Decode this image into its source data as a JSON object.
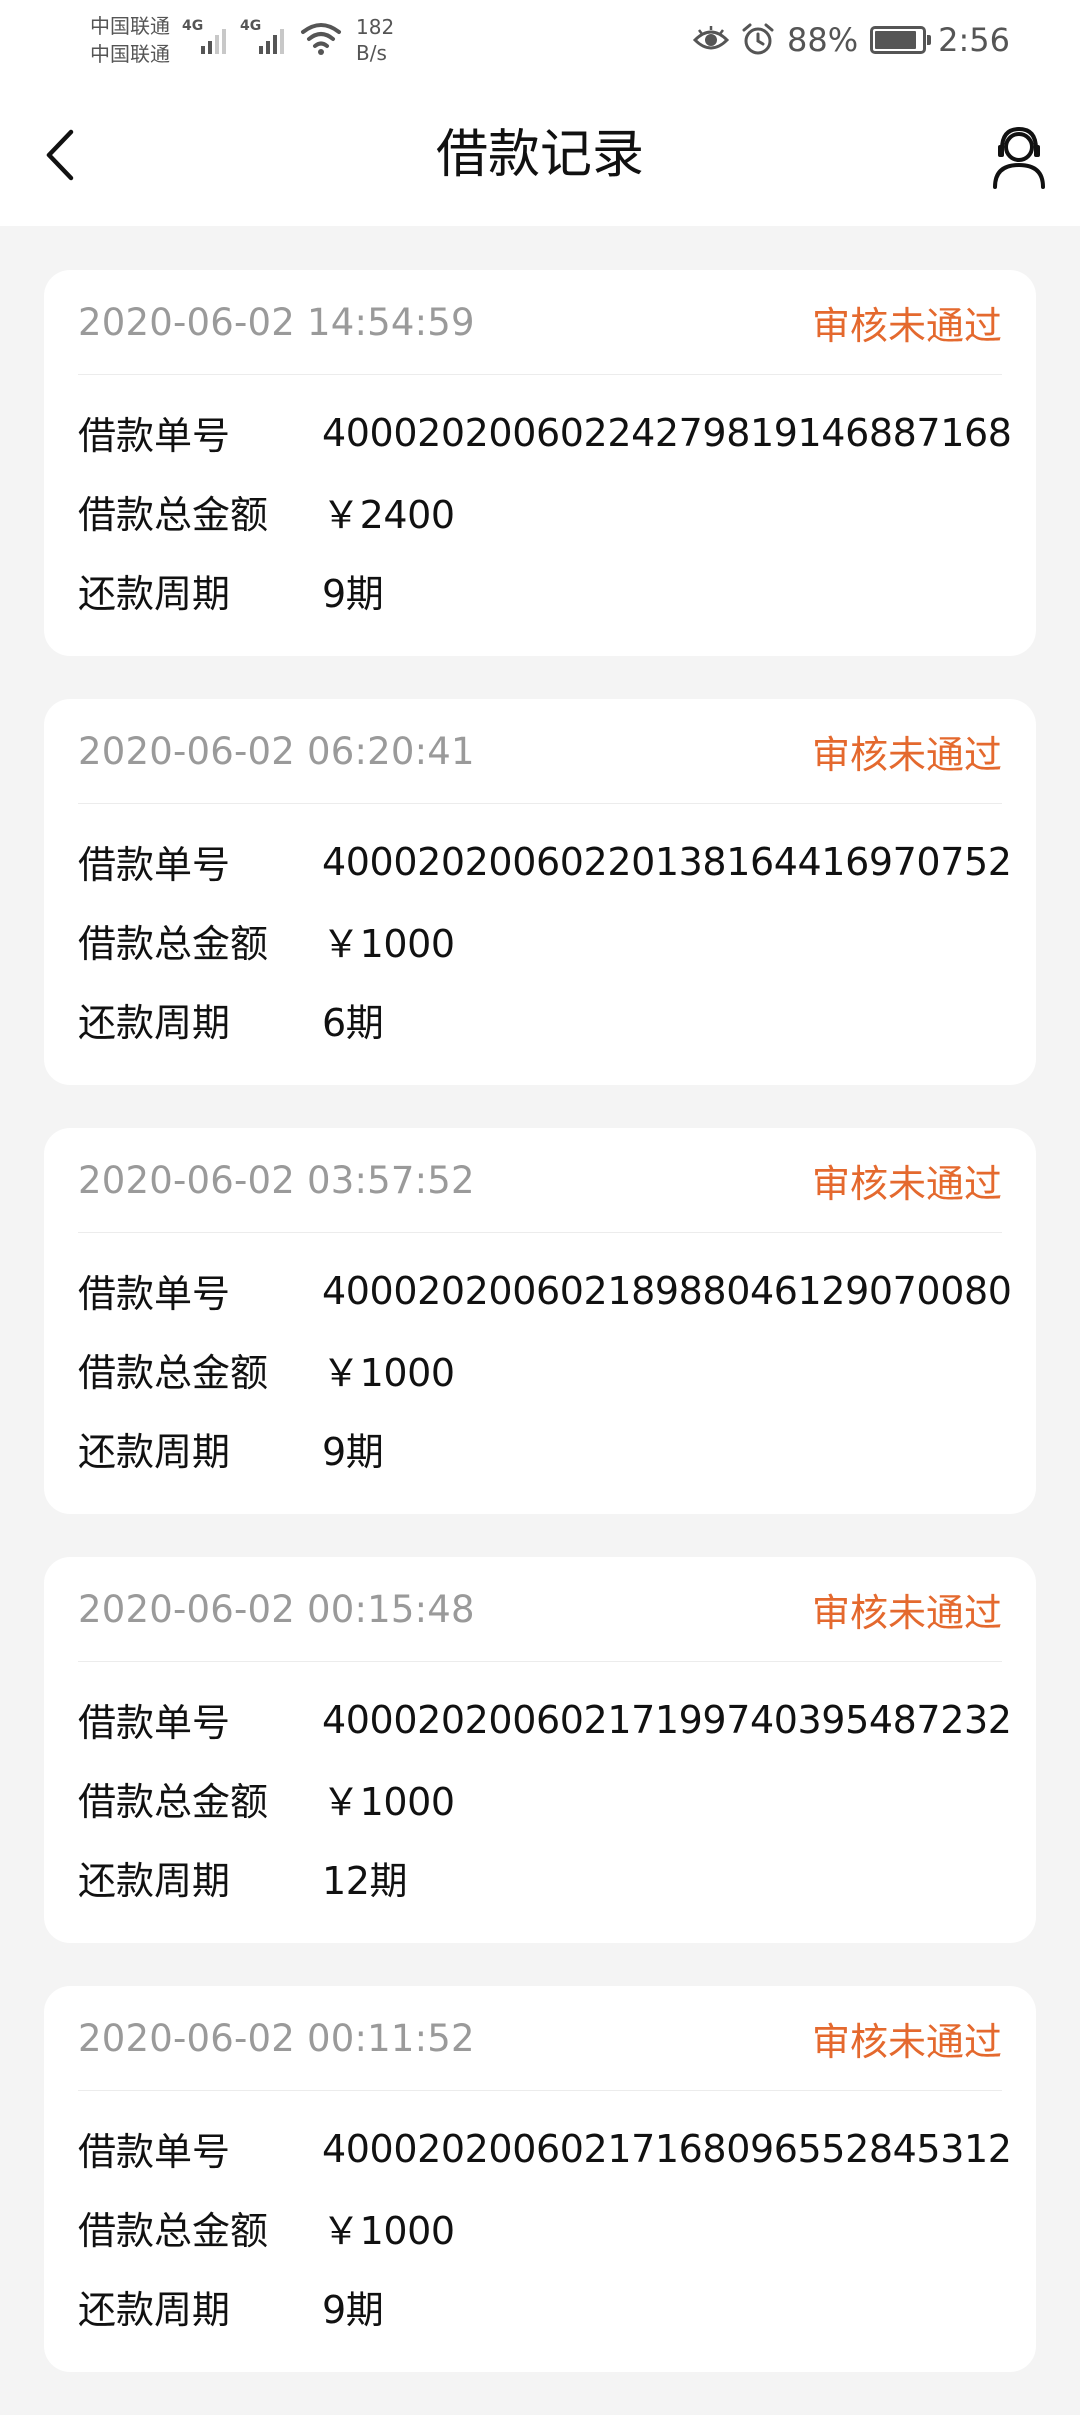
{
  "status_bar": {
    "carrier_1": "中国联通",
    "carrier_2": "中国联通",
    "network_1": "4G",
    "network_2": "4G",
    "speed_value": "182",
    "speed_unit": "B/s",
    "battery": "88%",
    "battery_level": 0.88,
    "time": "2:56",
    "icons": [
      "eye-comfort-icon",
      "alarm-icon",
      "battery-icon",
      "wifi-icon",
      "signal-icon"
    ]
  },
  "nav": {
    "title": "借款记录",
    "back_icon": "chevron-left-icon",
    "service_icon": "customer-service-icon"
  },
  "labels": {
    "order_no": "借款单号",
    "total_amount": "借款总金额",
    "period": "还款周期"
  },
  "colors": {
    "status": "#e4692e",
    "timestamp": "#9a9a9a",
    "background": "#f4f4f4"
  },
  "records": [
    {
      "time": "2020-06-02 14:54:59",
      "status": "审核未通过",
      "order_no": "40002020060224279819146887168",
      "amount": "￥2400",
      "period": "9期"
    },
    {
      "time": "2020-06-02 06:20:41",
      "status": "审核未通过",
      "order_no": "40002020060220138164416970752",
      "amount": "￥1000",
      "period": "6期"
    },
    {
      "time": "2020-06-02 03:57:52",
      "status": "审核未通过",
      "order_no": "40002020060218988046129070080",
      "amount": "￥1000",
      "period": "9期"
    },
    {
      "time": "2020-06-02 00:15:48",
      "status": "审核未通过",
      "order_no": "40002020060217199740395487232",
      "amount": "￥1000",
      "period": "12期"
    },
    {
      "time": "2020-06-02 00:11:52",
      "status": "审核未通过",
      "order_no": "40002020060217168096552845312",
      "amount": "￥1000",
      "period": "9期"
    }
  ]
}
